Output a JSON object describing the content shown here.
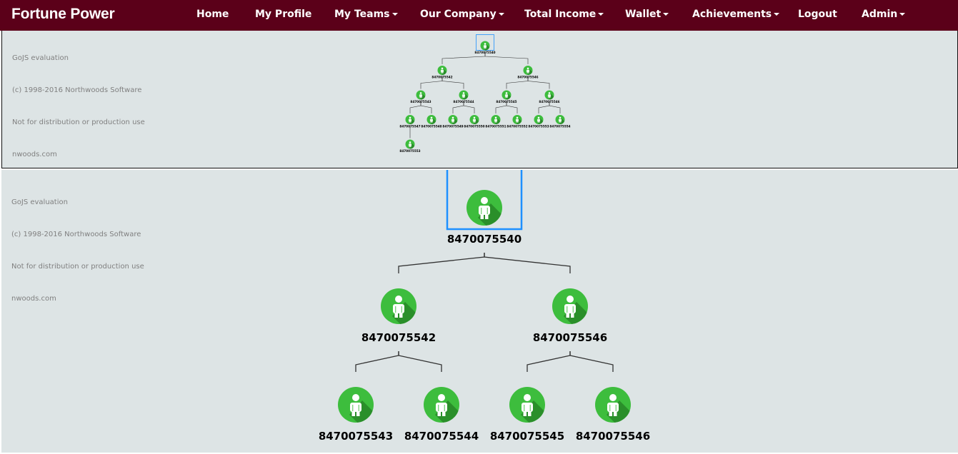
{
  "navbar": {
    "brand": "Fortune Power",
    "items": [
      {
        "label": "Home",
        "dropdown": false
      },
      {
        "label": "My Profile",
        "dropdown": false
      },
      {
        "label": "My Teams",
        "dropdown": true
      },
      {
        "label": "Our Company",
        "dropdown": true
      },
      {
        "label": "Total Income",
        "dropdown": true
      },
      {
        "label": "Wallet",
        "dropdown": true
      },
      {
        "label": "Achievements",
        "dropdown": true
      },
      {
        "label": "Logout",
        "dropdown": false
      },
      {
        "label": "Admin",
        "dropdown": true
      }
    ]
  },
  "watermark": {
    "lines": [
      "GoJS evaluation",
      "(c) 1998-2016 Northwoods Software",
      "Not for distribution or production use",
      "nwoods.com"
    ]
  },
  "colors": {
    "navbar_bg": "#5b0019",
    "canvas_bg": "#dde4e5",
    "node_green": "#3dbd3d",
    "node_shadow": "#2a8f2a",
    "selection": "#1e90ff",
    "link": "#333333"
  },
  "icons": {
    "node": "person-icon"
  },
  "overview_tree": {
    "id": "8470075540",
    "selected": true,
    "children": [
      {
        "id": "8470075542",
        "children": [
          {
            "id": "8470075543",
            "children": [
              {
                "id": "8470075547",
                "children": [
                  {
                    "id": "8470075553",
                    "children": []
                  }
                ]
              },
              {
                "id": "8470075548",
                "children": []
              }
            ]
          },
          {
            "id": "8470075544",
            "children": [
              {
                "id": "8470075549",
                "children": []
              },
              {
                "id": "8470075550",
                "children": []
              }
            ]
          }
        ]
      },
      {
        "id": "8470075546",
        "children": [
          {
            "id": "8470075545",
            "children": [
              {
                "id": "8470075551",
                "children": []
              },
              {
                "id": "8470075552",
                "children": []
              }
            ]
          },
          {
            "id": "8470075546",
            "children": [
              {
                "id": "8470075553",
                "children": []
              },
              {
                "id": "8470075554",
                "children": []
              }
            ]
          }
        ]
      }
    ]
  },
  "main_tree": {
    "id": "8470075540",
    "selected": true,
    "children": [
      {
        "id": "8470075542",
        "children": [
          {
            "id": "8470075543",
            "children": []
          },
          {
            "id": "8470075544",
            "children": []
          }
        ]
      },
      {
        "id": "8470075546",
        "children": [
          {
            "id": "8470075545",
            "children": []
          },
          {
            "id": "8470075546",
            "children": []
          }
        ]
      }
    ]
  }
}
